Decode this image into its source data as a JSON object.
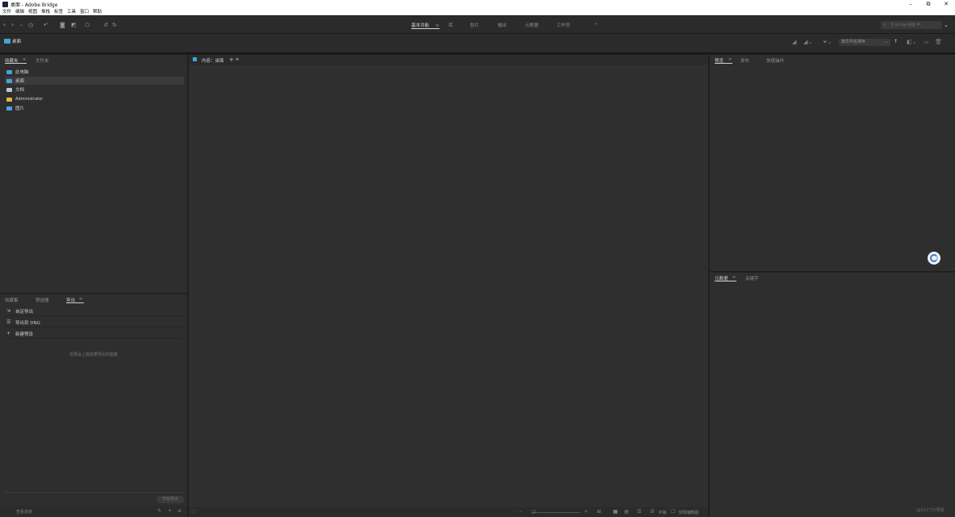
{
  "window": {
    "title": "桌面 - Adobe Bridge"
  },
  "menu": [
    "文件",
    "编辑",
    "视图",
    "堆栈",
    "标签",
    "工具",
    "窗口",
    "帮助"
  ],
  "workspaces": {
    "items": [
      "基本功能",
      "库",
      "胶片",
      "输出",
      "元数据",
      "工作流"
    ],
    "more": "»"
  },
  "search": {
    "placeholder": "在 Bridge 搜索 中..."
  },
  "pathbar": {
    "location": "桌面",
    "sort_label": "按文件名排序"
  },
  "left_top": {
    "tabs": [
      "收藏夹",
      "文件夹"
    ],
    "items": [
      {
        "label": "此电脑",
        "icon": "computer-icon",
        "color": "#4aa3d6"
      },
      {
        "label": "桌面",
        "icon": "desktop-icon",
        "color": "#4aa3d6"
      },
      {
        "label": "文档",
        "icon": "documents-icon",
        "color": "#bfc7d2"
      },
      {
        "label": "Administrator",
        "icon": "user-folder-icon",
        "color": "#e8b540"
      },
      {
        "label": "图片",
        "icon": "pictures-icon",
        "color": "#4aa3d6"
      }
    ]
  },
  "left_bottom": {
    "tabs": [
      "收藏集",
      "筛选器",
      "导出"
    ],
    "rows": [
      {
        "label": "自定导出",
        "icon": "export-icon"
      },
      {
        "label": "导出到 DNG",
        "icon": "list-icon"
      },
      {
        "label": "新建预设",
        "icon": "plus-icon"
      }
    ],
    "hint": "在预设上拖放要导出的图像",
    "start_export": "开始导出",
    "view_progress": "查看进度"
  },
  "center": {
    "tab_label": "内容：桌面"
  },
  "right_top": {
    "tabs": [
      "预览",
      "发布",
      "快速操作"
    ]
  },
  "right_bottom": {
    "tabs": [
      "元数据",
      "关键字"
    ]
  },
  "bottom_bar": {
    "lock_label": "平铺",
    "thumbnail_label": "仅限缩略图"
  },
  "watermark": "@51CTO博客",
  "colors": {
    "accent": "#3da7d8",
    "panel": "#2e2e2e",
    "background": "#202020"
  }
}
